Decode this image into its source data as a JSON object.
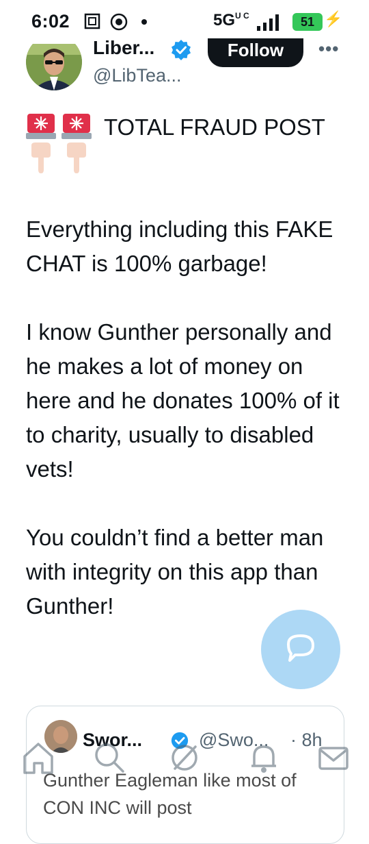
{
  "status_bar": {
    "time": "6:02",
    "network": "5G",
    "network_sub": "U C",
    "battery": "51"
  },
  "author": {
    "display_name": "Liber...",
    "handle": "@LibTea...",
    "verified": true
  },
  "actions": {
    "follow_label": "Follow",
    "more_label": "•••"
  },
  "tweet": {
    "headline": "TOTAL FRAUD POST",
    "paragraphs": [
      "Everything including this FAKE CHAT is 100% garbage!",
      "I know Gunther personally and he makes a lot of money on here and he donates 100% of it to charity, usually to disabled vets!",
      "You couldn’t find a better man with integrity on this app than Gunther!"
    ]
  },
  "quoted_tweet": {
    "display_name": "Swor...",
    "handle": "@Swo...",
    "time": "· 8h",
    "text": "Gunther Eagleman like most of CON INC will post"
  },
  "colors": {
    "accent": "#1d9bf0",
    "text": "#0f1419",
    "muted": "#536471",
    "battery": "#34c759",
    "siren_red": "#e0304a"
  },
  "icons": [
    "screenshot-icon",
    "record-icon",
    "signal-icon",
    "bolt-icon",
    "siren-icon",
    "point-down-icon",
    "reply-icon",
    "home-icon",
    "search-icon",
    "grok-icon",
    "bell-icon",
    "mail-icon"
  ]
}
